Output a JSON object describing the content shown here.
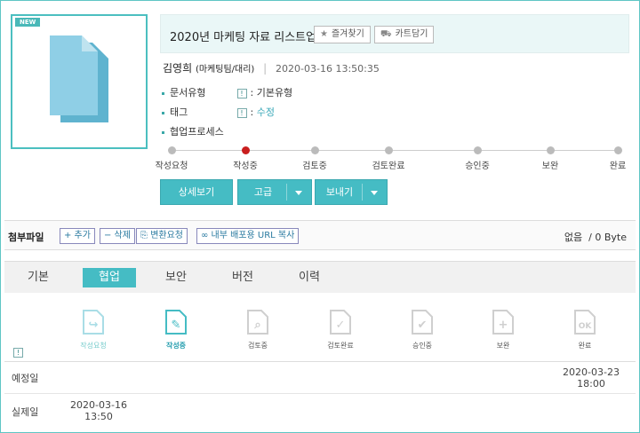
{
  "thumbnail": {
    "badge": "NEW",
    "icon": "document-icon"
  },
  "document": {
    "title": "2020년 마케팅 자료 리스트업",
    "favorite_label": "즐겨찾기",
    "cart_label": "카트담기",
    "author_name": "김영희",
    "author_dept": "(마케팅팀/대리)",
    "created_at": "2020-03-16 13:50:35"
  },
  "meta": {
    "doc_type_label": "문서유형",
    "doc_type_value": ": 기본유형",
    "tag_label": "태그",
    "tag_prefix": ":",
    "tag_edit": "수정",
    "process_label": "협업프로세스",
    "info_mark": "!"
  },
  "process": {
    "steps": [
      "작성요청",
      "작성중",
      "검토중",
      "검토완료",
      "승인중",
      "보완",
      "완료"
    ],
    "current_index": 1
  },
  "actions": {
    "detail_label": "상세보기",
    "advanced_label": "고급",
    "send_label": "보내기"
  },
  "attachments": {
    "label": "첨부파일",
    "add_label": "+ 추가",
    "delete_label": "− 삭제",
    "convert_label": "변환요청",
    "url_label": "내부 배포용 URL 복사",
    "status_none": "없음",
    "status_size": "/ 0 Byte"
  },
  "tabs": [
    "기본",
    "협업",
    "보안",
    "버전",
    "이력"
  ],
  "active_tab": 1,
  "workflow": {
    "steps": [
      "작성요청",
      "작성중",
      "검토중",
      "검토완료",
      "승인중",
      "보완",
      "완료"
    ],
    "icons": [
      "share-doc-icon",
      "edit-doc-icon",
      "search-doc-icon",
      "check-doc-icon",
      "approve-doc-icon",
      "add-doc-icon",
      "ok-doc-icon"
    ],
    "planned_label": "예정일",
    "actual_label": "실제일",
    "planned_date": "2020-03-23",
    "planned_time": "18:00",
    "actual_date": "2020-03-16",
    "actual_time": "13:50"
  },
  "colors": {
    "accent": "#45bcc4",
    "current_step": "#c91e1e",
    "border": "#5fc6c4"
  }
}
